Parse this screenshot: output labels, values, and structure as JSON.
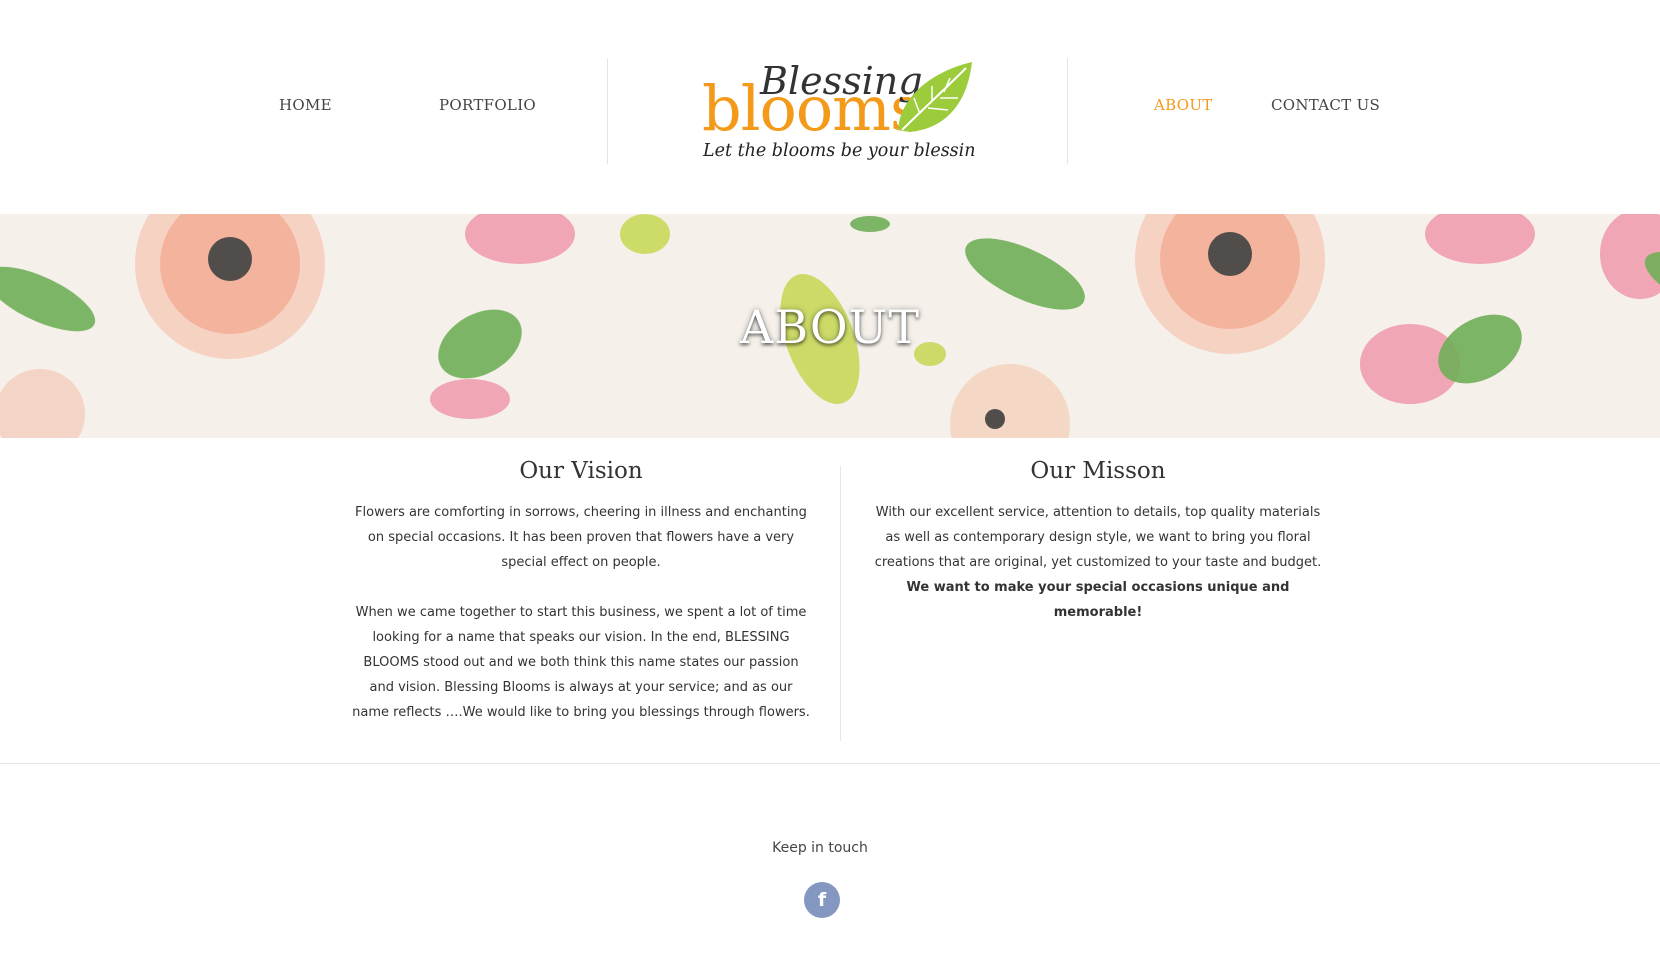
{
  "nav": {
    "home": "HOME",
    "portfolio": "PORTFOLIO",
    "about": "ABOUT",
    "contact": "CONTACT US",
    "active": "about"
  },
  "logo": {
    "script_word": "Blessing",
    "main_word": "blooms",
    "tagline": "Let the blooms be your blessings"
  },
  "hero": {
    "title": "ABOUT"
  },
  "vision": {
    "heading": "Our Vision",
    "p1": "Flowers are comforting in sorrows, cheering in illness and enchanting on special occasions. It has been proven that flowers have a very special effect on people.",
    "p2": "When we came together to start this business, we spent a lot of time looking for a name that speaks our vision. In the end, BLESSING BLOOMS stood out and we both think this name states our passion and vision. Blessing Blooms is always at your service; and as our name reflects ….We would like to bring you blessings through flowers."
  },
  "mission": {
    "heading": "Our Misson",
    "p1": "With our excellent service, attention to details, top quality materials as well as contemporary design style, we want to bring you floral creations that are original, yet customized to your taste and budget.",
    "p1_bold": "We want to make your special occasions unique and memorable!"
  },
  "footer": {
    "keep_in_touch": "Keep in touch",
    "facebook_glyph": "f",
    "facebook_icon": "facebook-icon"
  },
  "colors": {
    "accent": "#f39a1b",
    "logo_orange": "#f39a1b",
    "leaf_green": "#9ccb3b",
    "facebook": "#8497c0",
    "text": "#333333"
  }
}
